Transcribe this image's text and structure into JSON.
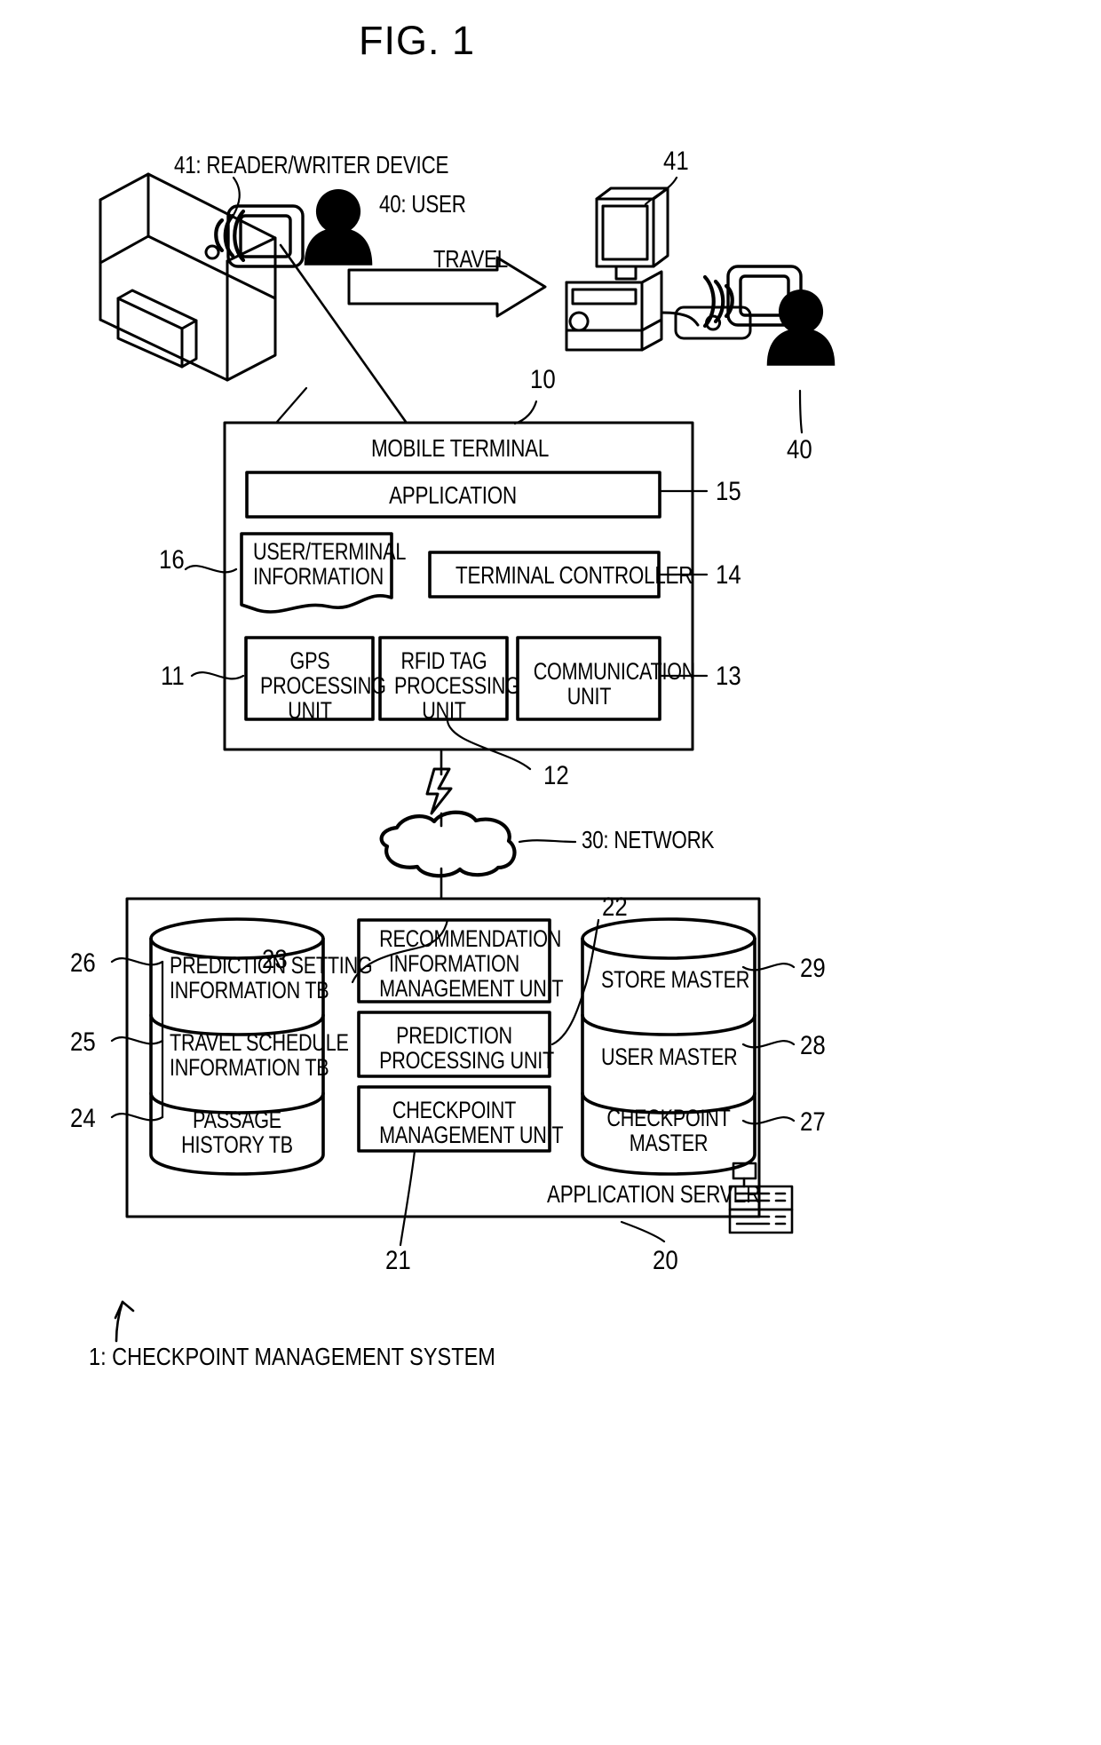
{
  "figure": {
    "title": "FIG. 1",
    "caption": "1: CHECKPOINT MANAGEMENT SYSTEM"
  },
  "top_scene": {
    "reader_writer_label": "41: READER/WRITER DEVICE",
    "user_label": "40: USER",
    "travel_label": "TRAVEL",
    "right_reader_number": "41",
    "right_user_number": "40"
  },
  "mobile_terminal": {
    "ref": "10",
    "title": "MOBILE TERMINAL",
    "blocks": [
      {
        "ref": "15",
        "label": "APPLICATION"
      },
      {
        "ref": "16",
        "label": "USER/TERMINAL\nINFORMATION"
      },
      {
        "ref": "14",
        "label": "TERMINAL CONTROLLER"
      },
      {
        "ref": "11",
        "label": "GPS\nPROCESSING\nUNIT"
      },
      {
        "ref": "12",
        "label": "RFID TAG\nPROCESSING\nUNIT"
      },
      {
        "ref": "13",
        "label": "COMMUNICATION\nUNIT"
      }
    ]
  },
  "network": {
    "ref": "30",
    "label": "30: NETWORK"
  },
  "application_server": {
    "ref": "20",
    "title": "APPLICATION SERVER",
    "databases_left": [
      {
        "ref": "26",
        "label": "PREDICTION SETTING\nINFORMATION TB"
      },
      {
        "ref": "25",
        "label": "TRAVEL SCHEDULE\nINFORMATION TB"
      },
      {
        "ref": "24",
        "label": "PASSAGE\nHISTORY TB"
      }
    ],
    "units_center": [
      {
        "ref": "23",
        "label": "RECOMMENDATION\nINFORMATION\nMANAGEMENT UNIT"
      },
      {
        "ref": "22",
        "label": "PREDICTION\nPROCESSING UNIT"
      },
      {
        "ref": "21",
        "label": "CHECKPOINT\nMANAGEMENT UNIT"
      }
    ],
    "databases_right": [
      {
        "ref": "29",
        "label": "STORE MASTER"
      },
      {
        "ref": "28",
        "label": "USER MASTER"
      },
      {
        "ref": "27",
        "label": "CHECKPOINT\nMASTER"
      }
    ]
  },
  "colors": {
    "ink": "#000000",
    "paper": "#ffffff"
  }
}
